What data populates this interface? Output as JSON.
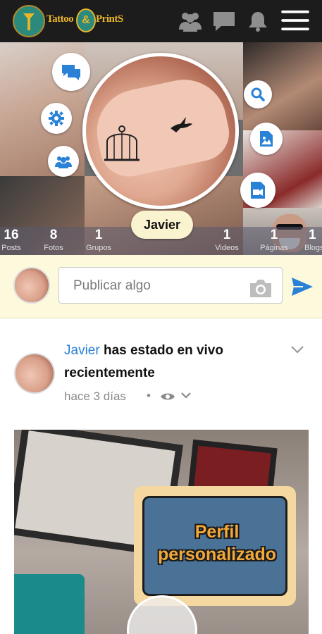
{
  "app": {
    "logo_text_a": "Tattoo",
    "logo_amp": "&",
    "logo_text_b": "PrintS",
    "nav_icons": [
      "friends-icon",
      "chat-icon",
      "bell-icon",
      "menu-icon"
    ]
  },
  "profile": {
    "name": "Javier",
    "action_buttons": [
      "messages-icon",
      "gear-icon",
      "group-icon",
      "search-icon",
      "photo-icon",
      "video-icon"
    ]
  },
  "stats": [
    {
      "num": "16",
      "label": "Posts"
    },
    {
      "num": "8",
      "label": "Fotos"
    },
    {
      "num": "1",
      "label": "Grupos"
    },
    {
      "num": "1",
      "label": "Videos"
    },
    {
      "num": "1",
      "label": "Páginas"
    },
    {
      "num": "1",
      "label": "Blogs"
    }
  ],
  "publish": {
    "placeholder": "Publicar algo",
    "camera_icon": "camera-icon",
    "send_icon": "send-icon"
  },
  "post": {
    "author": "Javier",
    "action_a": "has estado en vivo",
    "action_b": "recientemente",
    "time": "hace 3 días",
    "separator": "•",
    "banner_line1": "Perfil",
    "banner_line2": "personalizado"
  },
  "colors": {
    "topbar": "#1c1c1c",
    "accent_blue": "#2a82d7",
    "publish_bg": "#fcf9dc",
    "name_pill": "#f9f3cf",
    "logo_gold": "#e9b52a"
  }
}
